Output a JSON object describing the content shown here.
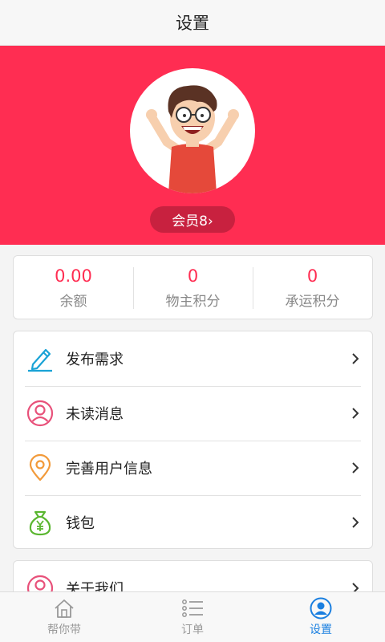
{
  "header": {
    "title": "设置"
  },
  "profile": {
    "member_label": "会员8›"
  },
  "stats": [
    {
      "value": "0.00",
      "label": "余额"
    },
    {
      "value": "0",
      "label": "物主积分"
    },
    {
      "value": "0",
      "label": "承运积分"
    }
  ],
  "menu": [
    {
      "label": "发布需求",
      "icon": "pencil-icon"
    },
    {
      "label": "未读消息",
      "icon": "user-circle-icon"
    },
    {
      "label": "完善用户信息",
      "icon": "location-pin-icon"
    },
    {
      "label": "钱包",
      "icon": "money-bag-icon"
    }
  ],
  "menu2": [
    {
      "label": "关于我们",
      "icon": "user-circle-icon"
    }
  ],
  "tabs": [
    {
      "label": "帮你带",
      "icon": "home-icon",
      "active": false
    },
    {
      "label": "订单",
      "icon": "list-icon",
      "active": false
    },
    {
      "label": "设置",
      "icon": "person-icon",
      "active": true
    }
  ],
  "colors": {
    "accent": "#ff2d52",
    "tab_active": "#1a7fe0"
  }
}
